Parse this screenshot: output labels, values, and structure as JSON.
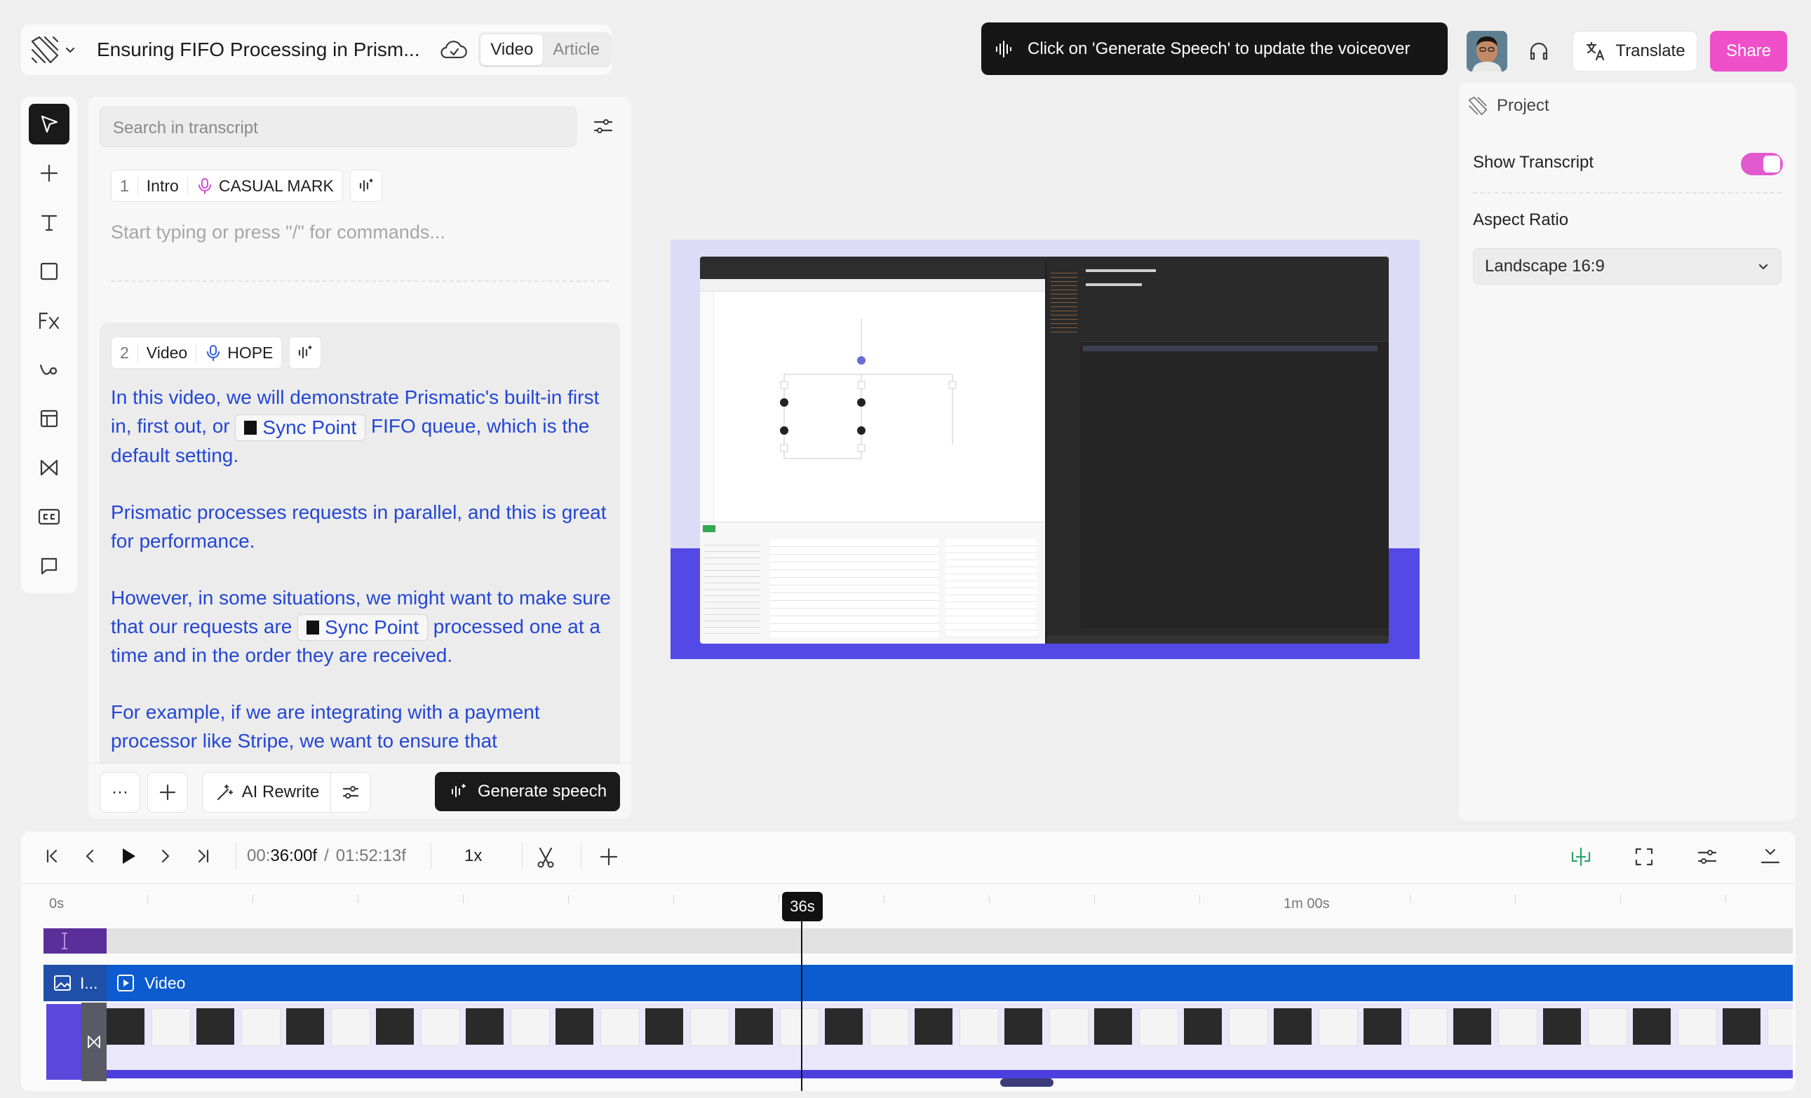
{
  "header": {
    "project_title": "Ensuring FIFO Processing in Prism...",
    "mode_video": "Video",
    "mode_article": "Article"
  },
  "toast": {
    "message": "Click on 'Generate Speech' to update the voiceover"
  },
  "top_right": {
    "translate_label": "Translate",
    "share_label": "Share"
  },
  "transcript": {
    "search_placeholder": "Search in transcript",
    "scene1": {
      "number": "1",
      "name": "Intro",
      "voice": "CASUAL MARK",
      "placeholder": "Start typing or press \"/\" for commands..."
    },
    "scene2": {
      "number": "2",
      "name": "Video",
      "voice": "HOPE",
      "p1_line1": "In this video, we will demonstrate Prismatic's built-in first",
      "p1_line2a": "in, first out, or",
      "sync_label": "Sync Point",
      "p1_line2b": "FIFO queue, which is the",
      "p1_line3": "default setting.",
      "p2_line1": "Prismatic processes requests in parallel, and this is great",
      "p2_line2": "for performance.",
      "p3_line1": "However, in some situations, we might want to make sure",
      "p3_line2a": "that our requests are",
      "p3_line2b": "processed one at a",
      "p3_line3": "time and in the order they are received.",
      "p4_line1": "For example, if we are integrating with a payment",
      "p4_line2": "processor like Stripe, we want to ensure that"
    },
    "toolbar": {
      "more": "···",
      "ai_rewrite": "AI Rewrite",
      "generate_speech": "Generate speech"
    }
  },
  "right_panel": {
    "section": "Project",
    "show_transcript_label": "Show Transcript",
    "show_transcript_on": true,
    "aspect_ratio_label": "Aspect Ratio",
    "aspect_ratio_value": "Landscape 16:9"
  },
  "timeline": {
    "current_time_prefix": "00:",
    "current_time_main": "36:00f",
    "separator": "/",
    "total_time": "01:52:13f",
    "speed": "1x",
    "ruler_start": "0s",
    "ruler_mid": "1m 00s",
    "playhead_label": "36s",
    "clip_image_label": "I...",
    "clip_video_label": "Video"
  },
  "colors": {
    "accent_pink": "#ef4fc8",
    "transcript_blue": "#2346d6",
    "timeline_blue": "#0d5bd0",
    "intro_purple": "#5a2f9a",
    "preview_indigo": "#5249e6"
  }
}
